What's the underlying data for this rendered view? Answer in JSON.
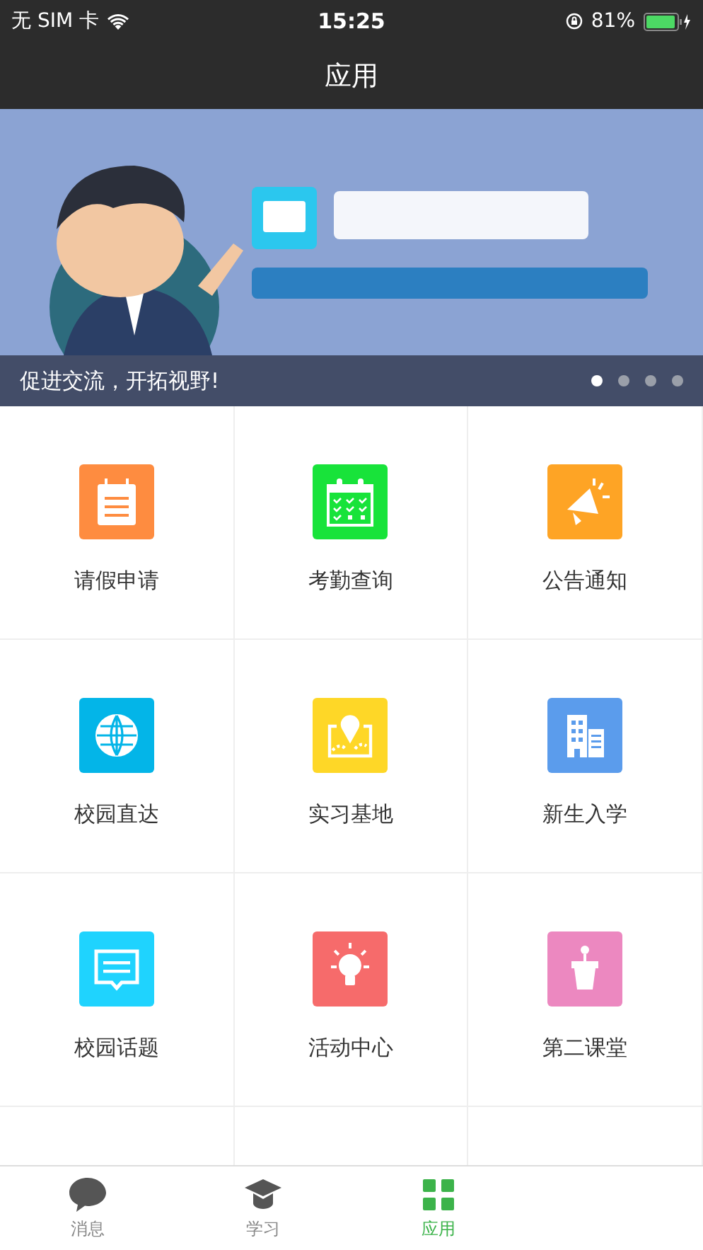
{
  "status_bar": {
    "carrier": "无 SIM 卡",
    "time": "15:25",
    "battery": "81%"
  },
  "nav_bar": {
    "title": "应用"
  },
  "banner": {
    "caption": "促进交流，开拓视野!",
    "dots": [
      {
        "selected": true
      },
      {
        "selected": false
      },
      {
        "selected": false
      },
      {
        "selected": false
      }
    ]
  },
  "apps": [
    {
      "label": "请假申请",
      "kind": "note",
      "color": "#fe8c40"
    },
    {
      "label": "考勤查询",
      "kind": "calendar",
      "color": "#18e33a"
    },
    {
      "label": "公告通知",
      "kind": "megaphone",
      "color": "#fea425"
    },
    {
      "label": "校园直达",
      "kind": "globe",
      "color": "#03b5e8"
    },
    {
      "label": "实习基地",
      "kind": "map",
      "color": "#fed727"
    },
    {
      "label": "新生入学",
      "kind": "building",
      "color": "#5b9cec"
    },
    {
      "label": "校园话题",
      "kind": "chat",
      "color": "#1fd3fe"
    },
    {
      "label": "活动中心",
      "kind": "bulb",
      "color": "#f66b6b"
    },
    {
      "label": "第二课堂",
      "kind": "podium",
      "color": "#ec88c0"
    }
  ],
  "tab_bar": [
    {
      "label": "消息",
      "kind": "chat",
      "selected": false
    },
    {
      "label": "学习",
      "kind": "cap",
      "selected": false
    },
    {
      "label": "应用",
      "kind": "grid",
      "selected": true
    }
  ]
}
